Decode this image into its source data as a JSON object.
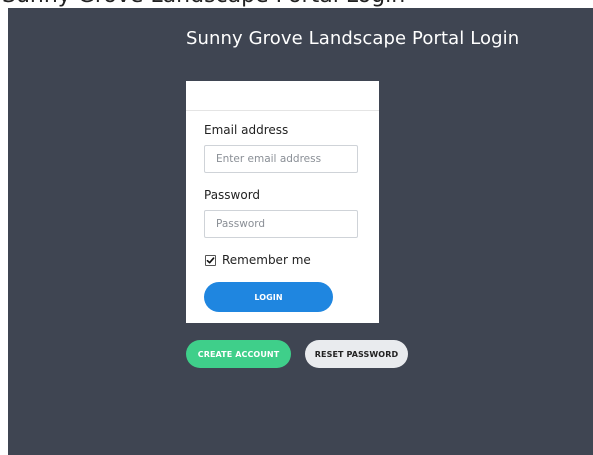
{
  "page_heading": "Sunny Grove Landscape Portal Login",
  "header": {
    "title": "Sunny Grove Landscape Portal Login"
  },
  "form": {
    "email_label": "Email address",
    "email_placeholder": "Enter email address",
    "email_value": "",
    "password_label": "Password",
    "password_placeholder": "Password",
    "password_value": "",
    "remember_label": "Remember me",
    "remember_checked": true,
    "login_label": "LOGIN"
  },
  "actions": {
    "create_account_label": "CREATE ACCOUNT",
    "reset_password_label": "RESET PASSWORD"
  },
  "colors": {
    "background_panel": "#3f4552",
    "login_button": "#1f86e0",
    "create_account_button": "#3fcf8a",
    "reset_password_button": "#e9ebee"
  }
}
